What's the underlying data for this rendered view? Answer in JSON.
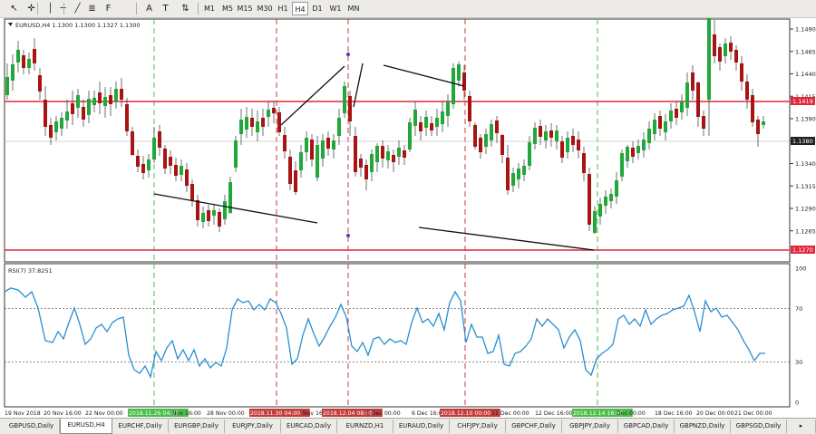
{
  "toolbar": {
    "icons": [
      "cursor-icon",
      "crosshair-icon",
      "vertical-line-icon",
      "horizontal-line-icon",
      "trendline-icon",
      "channel-icon",
      "fibonacci-icon",
      "text-icon",
      "text-label-icon",
      "arrows-icon"
    ],
    "text_tool": "A",
    "timeframes": [
      "M1",
      "M5",
      "M15",
      "M30",
      "H1",
      "H4",
      "D1",
      "W1",
      "MN"
    ],
    "active_timeframe": "H4"
  },
  "chart": {
    "symbol_header": "EURUSD,H4  1.1300 1.1300 1.1327 1.1300",
    "price_ticks": [
      "1.1490",
      "1.1465",
      "1.1440",
      "1.1415",
      "1.1390",
      "1.1365",
      "1.1340",
      "1.1315",
      "1.1290",
      "1.1265"
    ],
    "red_level_upper": "1.1419",
    "red_level_lower": "1.1270",
    "bid_label": "1.1380",
    "rsi_header": "RSI(7) 37.8251",
    "rsi_ticks": [
      "100",
      "70",
      "30",
      "0"
    ],
    "time_labels": [
      "19 Nov 2018",
      "20 Nov 16:00",
      "22 Nov 00:00",
      "2018.11.26 04:00",
      "Nov 16:00",
      "28 Nov 00:00",
      "2018.11.30 04:00",
      "Nov 16:00",
      "2018.12.04 08:00",
      "5 Dec 00:00",
      "6 Dec 16:00",
      "2018.12.10 00:00",
      "11 Dec 00:00",
      "12 Dec 16:00",
      "2018.12.14 16:00",
      "Dec 00:00",
      "18 Dec 16:00",
      "20 Dec 00:00",
      "21 Dec 00:00"
    ],
    "highlight_green_time": "2018.11.26 04:00",
    "highlight_red_times": [
      "2018.11.30 04:00",
      "2018.12.04 08:00",
      "2018.12.10 00:00"
    ],
    "highlight_green_time2": "2018.12.14 16:00",
    "colors": {
      "bull": "#22a83a",
      "bear": "#a81313",
      "level": "#e0283c",
      "rsi": "#2b8fd0",
      "green_vline": "#49bf49",
      "red_vline": "#c43b3b"
    }
  },
  "tabs": [
    "GBPUSD,Daily",
    "EURUSD,H4",
    "EURCHF,Daily",
    "EURGBP,Daily",
    "EURJPY,Daily",
    "EURCAD,Daily",
    "EURNZD,H1",
    "EURAUD,Daily",
    "CHFJPY,Daily",
    "GBPCHF,Daily",
    "GBPJPY,Daily",
    "GBPCAD,Daily",
    "GBPNZD,Daily",
    "GBPSGD,Daily"
  ],
  "active_tab": "EURUSD,H4"
}
